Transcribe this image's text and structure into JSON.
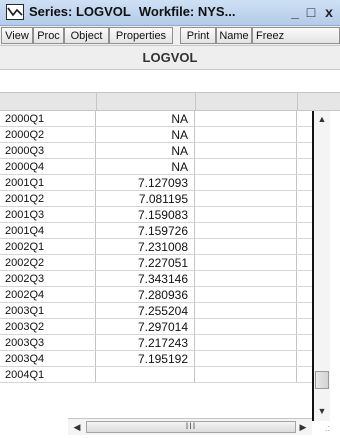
{
  "window": {
    "title_prefix": "Series: LOGVOL",
    "title_suffix": "Workfile: NYS...",
    "minimize_symbol": "_",
    "maximize_symbol": "□",
    "close_symbol": "x",
    "icon": "chart-line-icon",
    "accent_color": "#b3cbe9"
  },
  "toolbar": {
    "buttons": [
      "View",
      "Proc",
      "Object",
      "Properties",
      "Print",
      "Name",
      "Freez"
    ]
  },
  "series": {
    "name": "LOGVOL"
  },
  "rows": [
    {
      "obs": "2000Q1",
      "value": "NA"
    },
    {
      "obs": "2000Q2",
      "value": "NA"
    },
    {
      "obs": "2000Q3",
      "value": "NA"
    },
    {
      "obs": "2000Q4",
      "value": "NA"
    },
    {
      "obs": "2001Q1",
      "value": "7.127093"
    },
    {
      "obs": "2001Q2",
      "value": "7.081195"
    },
    {
      "obs": "2001Q3",
      "value": "7.159083"
    },
    {
      "obs": "2001Q4",
      "value": "7.159726"
    },
    {
      "obs": "2002Q1",
      "value": "7.231008"
    },
    {
      "obs": "2002Q2",
      "value": "7.227051"
    },
    {
      "obs": "2002Q3",
      "value": "7.343146"
    },
    {
      "obs": "2002Q4",
      "value": "7.280936"
    },
    {
      "obs": "2003Q1",
      "value": "7.255204"
    },
    {
      "obs": "2003Q2",
      "value": "7.297014"
    },
    {
      "obs": "2003Q3",
      "value": "7.217243"
    },
    {
      "obs": "2003Q4",
      "value": "7.195192"
    },
    {
      "obs": "2004Q1",
      "value": ""
    }
  ],
  "scrollbars": {
    "up_arrow": "▲",
    "down_arrow": "▼",
    "left_arrow": "◀",
    "right_arrow": "▶",
    "thumb_grip": "III",
    "size_grip": ".:"
  }
}
